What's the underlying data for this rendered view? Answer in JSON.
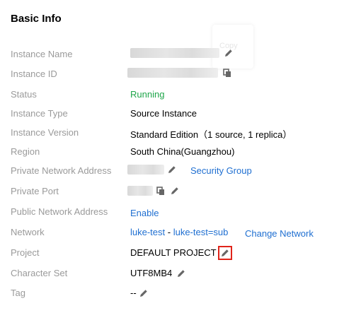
{
  "section_title": "Basic Info",
  "copy_tooltip": "Copy",
  "fields": {
    "instance_name": {
      "label": "Instance Name"
    },
    "instance_id": {
      "label": "Instance ID"
    },
    "status": {
      "label": "Status",
      "value": "Running"
    },
    "instance_type": {
      "label": "Instance Type",
      "value": "Source Instance"
    },
    "instance_version": {
      "label": "Instance Version",
      "value": "Standard Edition（1 source, 1 replica）"
    },
    "region": {
      "label": "Region",
      "value": "South China(Guangzhou)"
    },
    "private_network_address": {
      "label": "Private Network Address",
      "link": "Security Group"
    },
    "private_port": {
      "label": "Private Port"
    },
    "public_network_address": {
      "label": "Public Network Address",
      "link": "Enable"
    },
    "network": {
      "label": "Network",
      "vpc": "luke-test",
      "separator": " - ",
      "subnet": "luke-test=sub",
      "link": "Change Network"
    },
    "project": {
      "label": "Project",
      "value": "DEFAULT PROJECT"
    },
    "character_set": {
      "label": "Character Set",
      "value": "UTF8MB4"
    },
    "tag": {
      "label": "Tag",
      "value": "--"
    }
  },
  "colors": {
    "status_running": "#1fa64a",
    "link": "#1f6fd1",
    "label": "#9a9a9a",
    "highlight": "#e0241a"
  }
}
